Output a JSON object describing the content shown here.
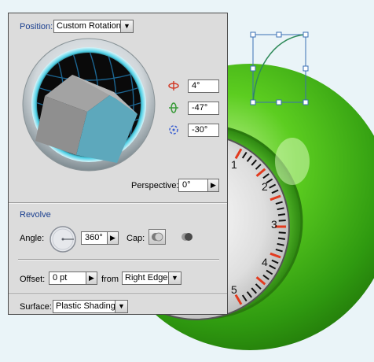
{
  "panel": {
    "position": {
      "label": "Position:",
      "preset_value": "Custom Rotation",
      "rot_x": "4°",
      "rot_y": "-47°",
      "rot_z": "-30°",
      "perspective_label": "Perspective:",
      "perspective_value": "0°"
    },
    "revolve": {
      "title": "Revolve",
      "angle_label": "Angle:",
      "angle_value": "360°",
      "cap_label": "Cap:",
      "offset_label": "Offset:",
      "offset_value": "0 pt",
      "from_label": "from",
      "from_value": "Right Edge"
    },
    "surface": {
      "label": "Surface:",
      "value": "Plastic Shading"
    }
  },
  "icons": {
    "x_axis": "x-axis-rotate-icon",
    "y_axis": "y-axis-rotate-icon",
    "z_axis": "z-axis-rotate-icon",
    "cap_on": "cap-on-icon",
    "cap_off": "cap-off-icon",
    "dropdown": "chevron-down-icon",
    "stepper": "chevron-right-icon"
  },
  "artwork": {
    "gauge_labels": [
      "1",
      "2",
      "3",
      "4",
      "5"
    ],
    "colors": {
      "sphere_green": "#3fb11c",
      "tick_red": "#e23a1e",
      "path_stroke": "#2f8a5a",
      "selection_blue": "#3a6fb5",
      "cube_top": "#9a9a9a",
      "cube_side": "#5aa0b4"
    }
  }
}
